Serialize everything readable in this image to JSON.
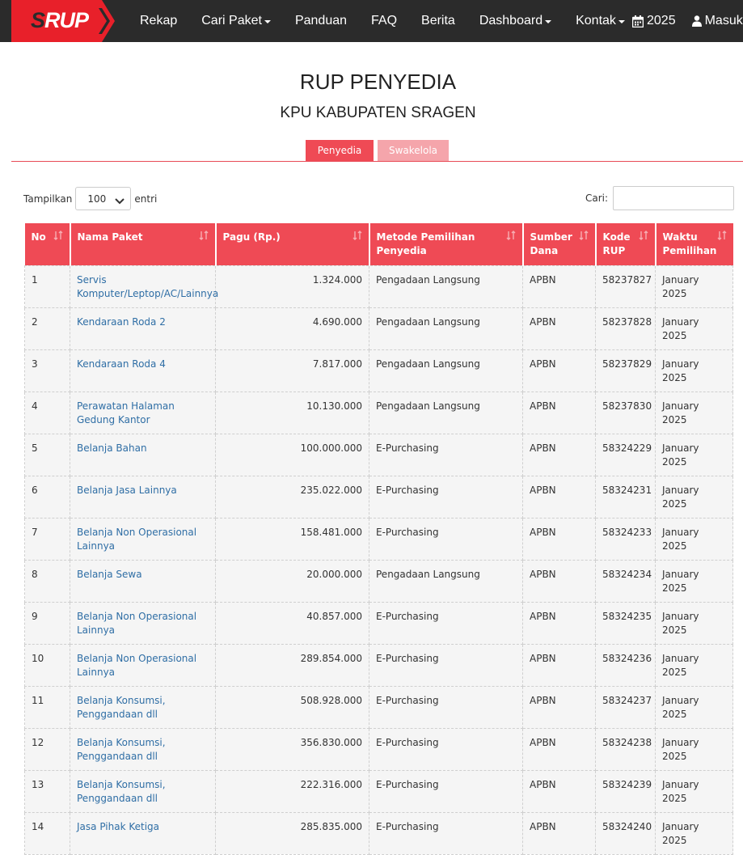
{
  "nav": {
    "logo_text": "RUP",
    "logo_s": "S",
    "items": [
      {
        "label": "Rekap",
        "caret": false
      },
      {
        "label": "Cari Paket",
        "caret": true
      },
      {
        "label": "Panduan",
        "caret": false
      },
      {
        "label": "FAQ",
        "caret": false
      },
      {
        "label": "Berita",
        "caret": false
      },
      {
        "label": "Dashboard",
        "caret": true
      },
      {
        "label": "Kontak",
        "caret": true
      }
    ],
    "year": "2025",
    "login": "Masuk"
  },
  "page": {
    "title": "RUP PENYEDIA",
    "subtitle": "KPU KABUPATEN SRAGEN"
  },
  "tabs": {
    "active": "Penyedia",
    "inactive": "Swakelola"
  },
  "controls": {
    "show_label": "Tampilkan",
    "show_value": "100",
    "entries_label": "entri",
    "search_label": "Cari:",
    "search_value": ""
  },
  "table": {
    "columns": [
      "No",
      "Nama Paket",
      "Pagu (Rp.)",
      "Metode Pemilihan Penyedia",
      "Sumber Dana",
      "Kode RUP",
      "Waktu Pemilihan"
    ],
    "rows": [
      {
        "no": "1",
        "nama": "Servis Komputer/Leptop/AC/Lainnya",
        "pagu": "1.324.000",
        "metode": "Pengadaan Langsung",
        "sumber": "APBN",
        "kode": "58237827",
        "waktu": "January 2025"
      },
      {
        "no": "2",
        "nama": "Kendaraan Roda 2",
        "pagu": "4.690.000",
        "metode": "Pengadaan Langsung",
        "sumber": "APBN",
        "kode": "58237828",
        "waktu": "January 2025"
      },
      {
        "no": "3",
        "nama": "Kendaraan Roda 4",
        "pagu": "7.817.000",
        "metode": "Pengadaan Langsung",
        "sumber": "APBN",
        "kode": "58237829",
        "waktu": "January 2025"
      },
      {
        "no": "4",
        "nama": "Perawatan Halaman Gedung Kantor",
        "pagu": "10.130.000",
        "metode": "Pengadaan Langsung",
        "sumber": "APBN",
        "kode": "58237830",
        "waktu": "January 2025"
      },
      {
        "no": "5",
        "nama": "Belanja Bahan",
        "pagu": "100.000.000",
        "metode": "E-Purchasing",
        "sumber": "APBN",
        "kode": "58324229",
        "waktu": "January 2025"
      },
      {
        "no": "6",
        "nama": "Belanja Jasa Lainnya",
        "pagu": "235.022.000",
        "metode": "E-Purchasing",
        "sumber": "APBN",
        "kode": "58324231",
        "waktu": "January 2025"
      },
      {
        "no": "7",
        "nama": "Belanja Non Operasional Lainnya",
        "pagu": "158.481.000",
        "metode": "E-Purchasing",
        "sumber": "APBN",
        "kode": "58324233",
        "waktu": "January 2025"
      },
      {
        "no": "8",
        "nama": "Belanja Sewa",
        "pagu": "20.000.000",
        "metode": "Pengadaan Langsung",
        "sumber": "APBN",
        "kode": "58324234",
        "waktu": "January 2025"
      },
      {
        "no": "9",
        "nama": "Belanja Non Operasional Lainnya",
        "pagu": "40.857.000",
        "metode": "E-Purchasing",
        "sumber": "APBN",
        "kode": "58324235",
        "waktu": "January 2025"
      },
      {
        "no": "10",
        "nama": "Belanja Non Operasional Lainnya",
        "pagu": "289.854.000",
        "metode": "E-Purchasing",
        "sumber": "APBN",
        "kode": "58324236",
        "waktu": "January 2025"
      },
      {
        "no": "11",
        "nama": "Belanja Konsumsi, Penggandaan dll",
        "pagu": "508.928.000",
        "metode": "E-Purchasing",
        "sumber": "APBN",
        "kode": "58324237",
        "waktu": "January 2025"
      },
      {
        "no": "12",
        "nama": "Belanja Konsumsi, Penggandaan dll",
        "pagu": "356.830.000",
        "metode": "E-Purchasing",
        "sumber": "APBN",
        "kode": "58324238",
        "waktu": "January 2025"
      },
      {
        "no": "13",
        "nama": "Belanja Konsumsi, Penggandaan dll",
        "pagu": "222.316.000",
        "metode": "E-Purchasing",
        "sumber": "APBN",
        "kode": "58324239",
        "waktu": "January 2025"
      },
      {
        "no": "14",
        "nama": "Jasa Pihak Ketiga",
        "pagu": "285.835.000",
        "metode": "E-Purchasing",
        "sumber": "APBN",
        "kode": "58324240",
        "waktu": "January 2025"
      }
    ]
  },
  "colors": {
    "navbar": "#2b2b2b",
    "accent": "#ef4a55",
    "tab_inactive": "#f5a5ab",
    "link": "#2f6ea5",
    "row_bg": "#f5f5f5"
  }
}
